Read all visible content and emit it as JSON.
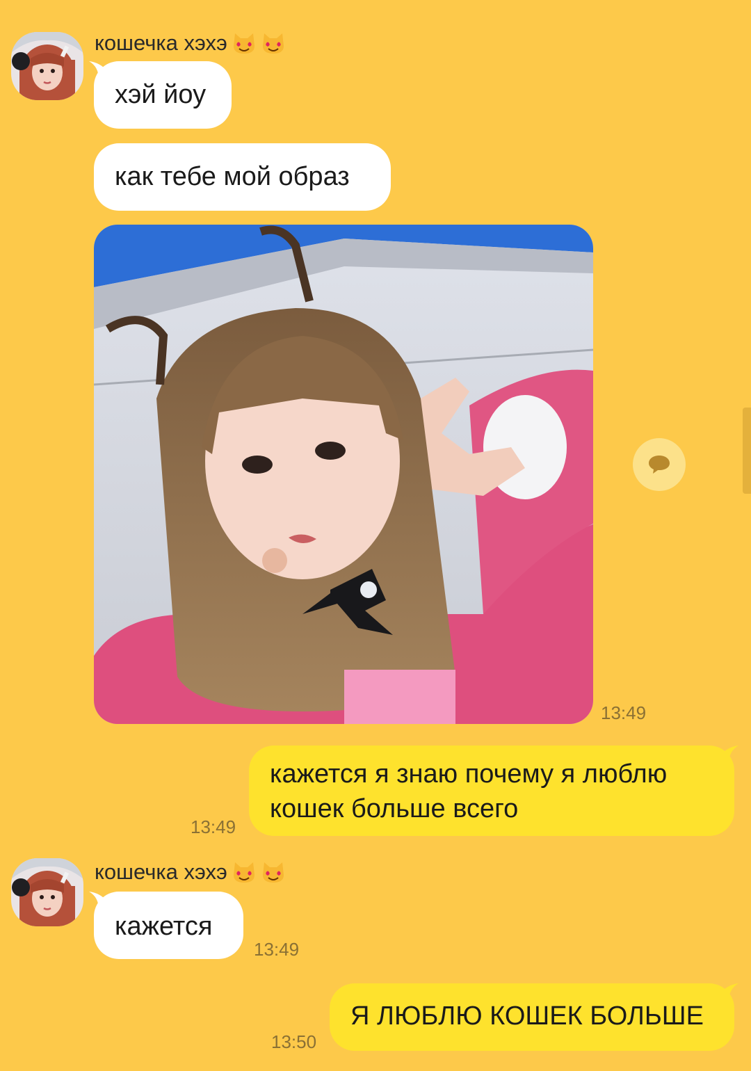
{
  "colors": {
    "background": "#FDC94A",
    "incoming_bubble": "#FFFFFF",
    "outgoing_bubble": "#FEE22D",
    "timestamp": "#8a7034"
  },
  "messages": [
    {
      "id": "m1",
      "sender": "кошечка хэхэ",
      "sender_icons": [
        "heart-eyes-cat-icon",
        "heart-eyes-cat-icon"
      ],
      "direction": "in",
      "text": "хэй йоу"
    },
    {
      "id": "m2",
      "direction": "in",
      "text": "как тебе мой образ"
    },
    {
      "id": "m3",
      "direction": "in",
      "type": "photo",
      "time": "13:49"
    },
    {
      "id": "m4",
      "direction": "out",
      "lines": [
        "кажется я знаю почему я люблю",
        "кошек больше всего"
      ],
      "time": "13:49"
    },
    {
      "id": "m5",
      "sender": "кошечка хэхэ",
      "sender_icons": [
        "heart-eyes-cat-icon",
        "heart-eyes-cat-icon"
      ],
      "direction": "in",
      "text": "кажется",
      "time": "13:49"
    },
    {
      "id": "m6",
      "direction": "out",
      "text": "Я ЛЮБЛЮ КОШЕК БОЛЬШЕ",
      "time": "13:50"
    }
  ]
}
